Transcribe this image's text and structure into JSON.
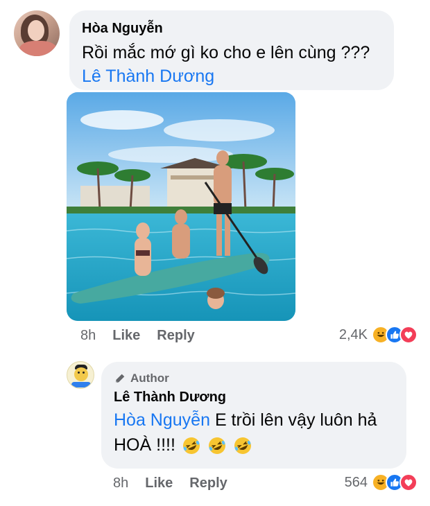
{
  "comment": {
    "author": "Hòa Nguyễn",
    "text": "Rồi mắc mớ gì ko cho e lên cùng ???",
    "mention": "Lê Thành Dương",
    "time": "8h",
    "like_label": "Like",
    "reply_label": "Reply",
    "reaction_count": "2,4K",
    "reactions": [
      "haha-icon",
      "like-icon",
      "love-icon"
    ]
  },
  "reply": {
    "badge": "Author",
    "author": "Lê Thành Dương",
    "mention": "Hòa Nguyễn",
    "text_line1": "E trồi lên vậy luôn hả",
    "text_line2": "HOÀ !!!!",
    "emojis": [
      "rolling-on-floor-laughing",
      "rolling-on-floor-laughing",
      "rolling-on-floor-laughing"
    ],
    "time": "8h",
    "like_label": "Like",
    "reply_label": "Reply",
    "reaction_count": "564",
    "reactions": [
      "haha-icon",
      "like-icon",
      "love-icon"
    ]
  },
  "colors": {
    "bubble": "#f0f2f5",
    "link": "#1877f2",
    "meta": "#65676b"
  }
}
